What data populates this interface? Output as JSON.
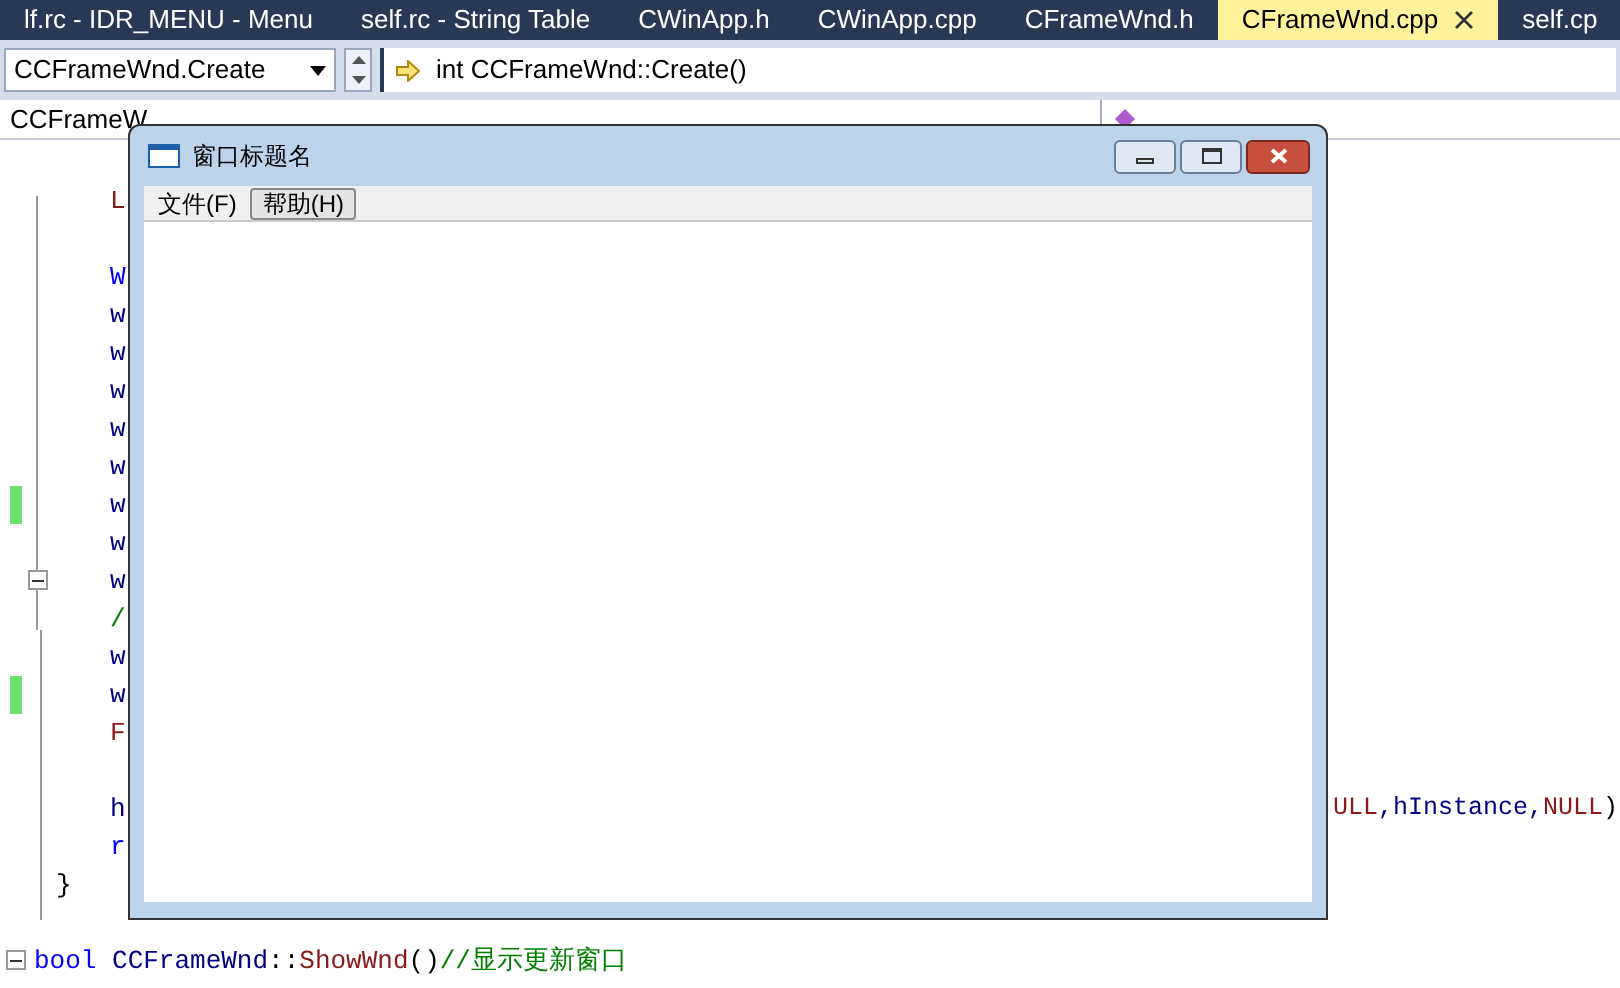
{
  "tabs": [
    {
      "label": "lf.rc - IDR_MENU - Menu",
      "selected": false
    },
    {
      "label": "self.rc - String Table",
      "selected": false
    },
    {
      "label": "CWinApp.h",
      "selected": false
    },
    {
      "label": "CWinApp.cpp",
      "selected": false
    },
    {
      "label": "CFrameWnd.h",
      "selected": false
    },
    {
      "label": "CFrameWnd.cpp",
      "selected": true
    },
    {
      "label": "self.cp",
      "selected": false
    }
  ],
  "navigation": {
    "scope": "CCFrameWnd.Create",
    "function": "int CCFrameWnd::Create()",
    "class": "CCFrameW"
  },
  "code_lines": [
    {
      "kind": "body"
    },
    {
      "kind": "body",
      "segments": [
        {
          "text": "L",
          "kind": "macro"
        }
      ]
    },
    {
      "kind": "body"
    },
    {
      "kind": "body",
      "segments": [
        {
          "text": "W",
          "kind": "keyword"
        }
      ]
    },
    {
      "kind": "body",
      "segments": [
        {
          "text": "w",
          "kind": "identifier"
        }
      ]
    },
    {
      "kind": "body",
      "segments": [
        {
          "text": "w",
          "kind": "identifier"
        }
      ]
    },
    {
      "kind": "body",
      "segments": [
        {
          "text": "w",
          "kind": "identifier"
        }
      ]
    },
    {
      "kind": "body",
      "segments": [
        {
          "text": "w",
          "kind": "identifier"
        }
      ]
    },
    {
      "kind": "body",
      "segments": [
        {
          "text": "w",
          "kind": "identifier"
        }
      ]
    },
    {
      "kind": "body",
      "changed": true,
      "segments": [
        {
          "text": "w",
          "kind": "identifier"
        }
      ]
    },
    {
      "kind": "body",
      "segments": [
        {
          "text": "w",
          "kind": "identifier"
        }
      ]
    },
    {
      "kind": "body",
      "fold": true,
      "segments": [
        {
          "text": "w",
          "kind": "identifier"
        }
      ]
    },
    {
      "kind": "body",
      "segments": [
        {
          "text": "/",
          "kind": "comment"
        }
      ]
    },
    {
      "kind": "body",
      "segments": [
        {
          "text": "w",
          "kind": "identifier"
        }
      ]
    },
    {
      "kind": "body",
      "changed": true,
      "segments": [
        {
          "text": "w",
          "kind": "identifier"
        }
      ]
    },
    {
      "kind": "body",
      "segments": [
        {
          "text": "F",
          "kind": "macro"
        }
      ]
    },
    {
      "kind": "body"
    },
    {
      "kind": "body",
      "segments": [
        {
          "text": "h",
          "kind": "identifier"
        }
      ],
      "tail": [
        {
          "text": "ULL",
          "kind": "macro"
        },
        {
          "text": ",hInstance,",
          "kind": "identifier"
        },
        {
          "text": "NULL",
          "kind": "macro"
        },
        {
          "text": ")",
          "kind": "plain"
        }
      ]
    },
    {
      "kind": "body",
      "segments": [
        {
          "text": "r",
          "kind": "keyword"
        }
      ]
    },
    {
      "kind": "brace",
      "segments": [
        {
          "text": "}",
          "kind": "plain"
        }
      ]
    },
    {
      "kind": "body"
    },
    {
      "kind": "top",
      "fold": true,
      "segments": [
        {
          "text": "bool",
          "kind": "keyword"
        },
        {
          "text": " CCFrameWnd",
          "kind": "identifier"
        },
        {
          "text": "::",
          "kind": "plain"
        },
        {
          "text": "ShowWnd",
          "kind": "function"
        },
        {
          "text": "()",
          "kind": "plain"
        },
        {
          "text": "//显示更新窗口",
          "kind": "comment"
        }
      ]
    }
  ],
  "child_window": {
    "title": "窗口标题名",
    "menu": [
      {
        "label": "文件(F)",
        "selected": false
      },
      {
        "label": "帮助(H)",
        "selected": true
      }
    ]
  }
}
